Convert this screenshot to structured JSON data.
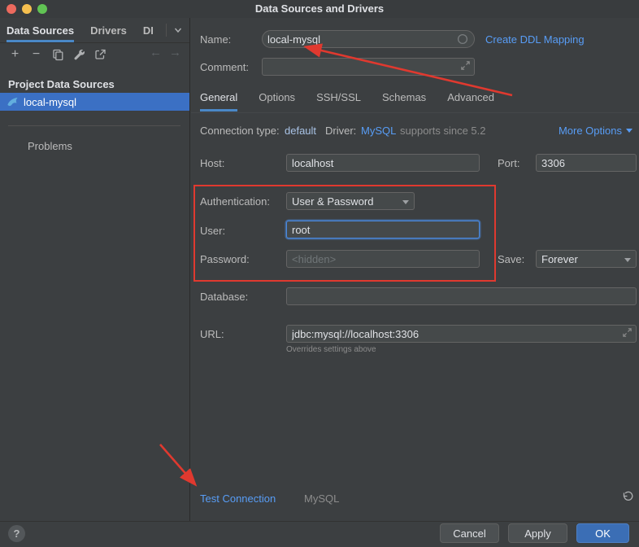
{
  "window": {
    "title": "Data Sources and Drivers"
  },
  "icons": {
    "add": "+",
    "remove": "−",
    "back": "←",
    "forward": "→",
    "copy": "copy-icon",
    "wrench": "wrench-icon",
    "export": "export-icon",
    "chevron_down": "chevron-down-icon",
    "expand": "expand-icon",
    "undo": "undo-icon",
    "mysql_dolphin": "mysql-dolphin-icon"
  },
  "sidebar": {
    "tabs": [
      {
        "label": "Data Sources",
        "active": true
      },
      {
        "label": "Drivers",
        "active": false
      },
      {
        "label": "DI",
        "active": false
      }
    ],
    "section_title": "Project Data Sources",
    "selected_item": "local-mysql",
    "problems_label": "Problems"
  },
  "header": {
    "name_label": "Name:",
    "name_value": "local-mysql",
    "ddl_link": "Create DDL Mapping",
    "comment_label": "Comment:",
    "comment_value": ""
  },
  "tabs": {
    "items": [
      "General",
      "Options",
      "SSH/SSL",
      "Schemas",
      "Advanced"
    ],
    "active": "General"
  },
  "general": {
    "connection_type_label": "Connection type:",
    "connection_type_value": "default",
    "driver_label": "Driver:",
    "driver_value": "MySQL",
    "driver_note": "supports since 5.2",
    "more_options": "More Options",
    "host_label": "Host:",
    "host_value": "localhost",
    "port_label": "Port:",
    "port_value": "3306",
    "auth_label": "Authentication:",
    "auth_value": "User & Password",
    "user_label": "User:",
    "user_value": "root",
    "password_label": "Password:",
    "password_placeholder": "<hidden>",
    "save_label": "Save:",
    "save_value": "Forever",
    "database_label": "Database:",
    "database_value": "",
    "url_label": "URL:",
    "url_value": "jdbc:mysql://localhost:3306",
    "url_note": "Overrides settings above"
  },
  "footer": {
    "test_connection": "Test Connection",
    "driver_name": "MySQL",
    "help": "?",
    "cancel": "Cancel",
    "apply": "Apply",
    "ok": "OK"
  },
  "colors": {
    "link": "#589df6",
    "selection": "#3b70c4",
    "tab_underline": "#4a88c7",
    "ok_button": "#3b6eb5",
    "annotation_red": "#e0392f",
    "field_background": "#45494a",
    "panel_background": "#3c3f41"
  }
}
